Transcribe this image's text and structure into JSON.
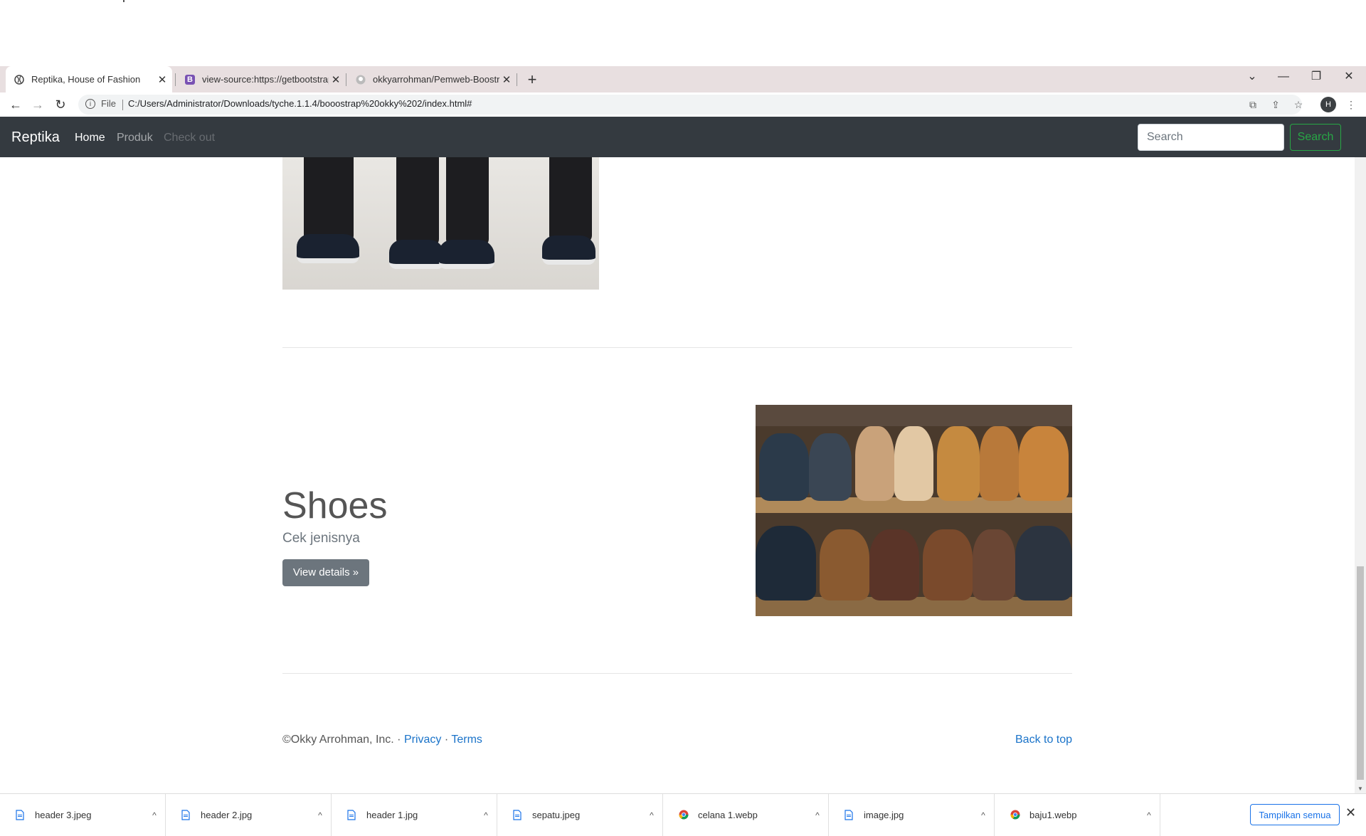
{
  "browser": {
    "tabs": [
      {
        "title": "Reptika, House of Fashion",
        "active": true
      },
      {
        "title": "view-source:https://getbootstrap.",
        "active": false
      },
      {
        "title": "okkyarrohman/Pemweb-Boostrap",
        "active": false
      }
    ],
    "address": {
      "file_label": "File",
      "url": "C:/Users/Administrator/Downloads/tyche.1.1.4/booostrap%20okky%202/index.html#"
    },
    "profile_initial": "H"
  },
  "navbar": {
    "brand": "Reptika",
    "links": [
      "Home",
      "Produk",
      "Check out"
    ],
    "search_placeholder": "Search",
    "search_button": "Search",
    "accent": "#28a745"
  },
  "main": {
    "feature": {
      "title": "Shoes",
      "subtitle": "Cek jenisnya",
      "button": "View details »"
    }
  },
  "footer": {
    "copyright": "©Okky Arrohman, Inc. · ",
    "privacy": "Privacy",
    "separator": " · ",
    "terms": "Terms",
    "back_to_top": "Back to top"
  },
  "downloads": {
    "items": [
      {
        "name": "header 3.jpeg",
        "icon": "file-icon"
      },
      {
        "name": "header 2.jpg",
        "icon": "file-icon"
      },
      {
        "name": "header 1.jpg",
        "icon": "file-icon"
      },
      {
        "name": "sepatu.jpeg",
        "icon": "file-icon"
      },
      {
        "name": "celana 1.webp",
        "icon": "chrome-icon"
      },
      {
        "name": "image.jpg",
        "icon": "file-icon"
      },
      {
        "name": "baju1.webp",
        "icon": "chrome-icon"
      }
    ],
    "show_all": "Tampilkan semua"
  }
}
